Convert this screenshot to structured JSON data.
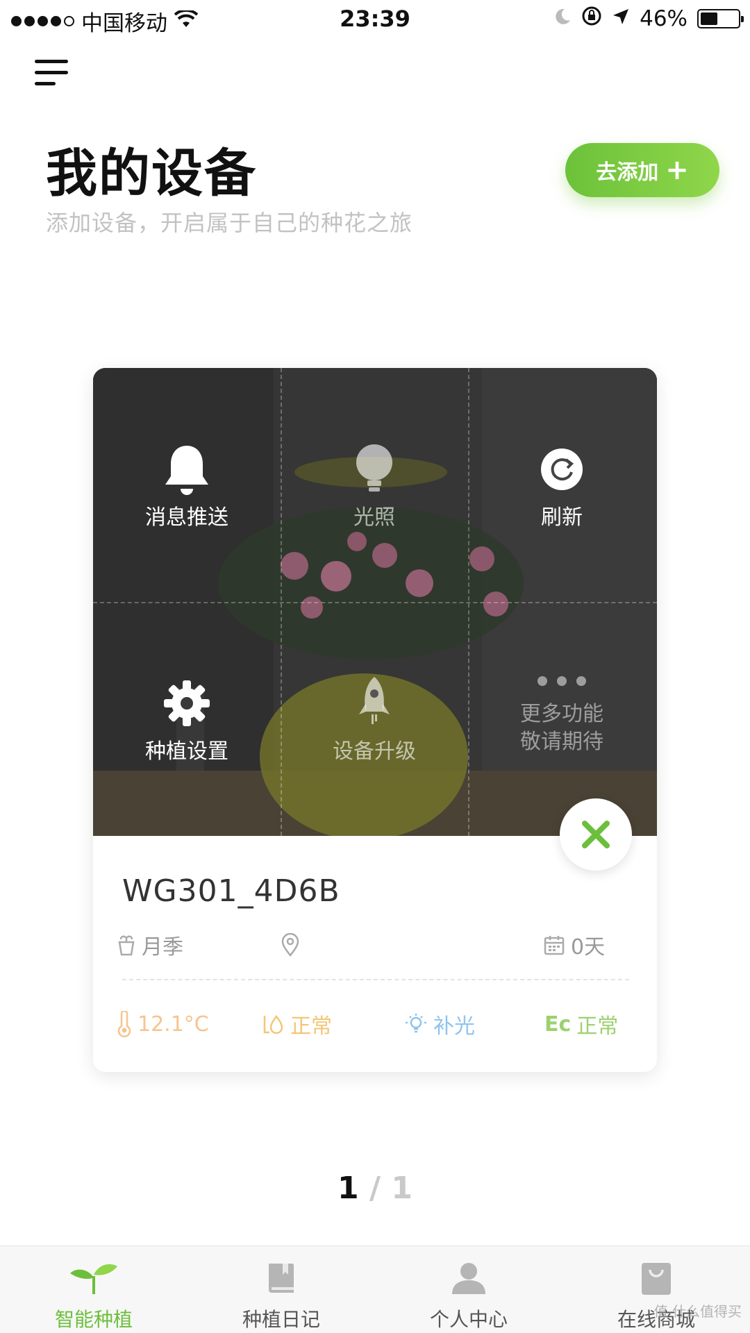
{
  "status_bar": {
    "carrier": "中国移动",
    "time": "23:39",
    "battery_percent": "46%",
    "battery_level": 0.46
  },
  "header": {
    "title": "我的设备",
    "subtitle": "添加设备，开启属于自己的种花之旅",
    "add_button": "去添加"
  },
  "device_card": {
    "actions": [
      {
        "label": "消息推送",
        "icon": "bell-icon"
      },
      {
        "label": "光照",
        "icon": "bulb-icon"
      },
      {
        "label": "刷新",
        "icon": "refresh-icon"
      },
      {
        "label": "种植设置",
        "icon": "gear-icon"
      },
      {
        "label": "设备升级",
        "icon": "rocket-icon"
      },
      {
        "label": "更多功能\n敬请期待",
        "icon": "more-dots-icon"
      }
    ],
    "name": "WG301_4D6B",
    "plant": "月季",
    "location": "",
    "days": "0天",
    "stats": {
      "temperature": "12.1°C",
      "water": "正常",
      "light": "补光",
      "ec_label": "Ec",
      "ec": "正常"
    },
    "colors": {
      "temperature": "#f6c48f",
      "water": "#f3c677",
      "light": "#8ec4ef",
      "ec": "#9dd16f",
      "accent": "#6cbf3c"
    }
  },
  "pager": {
    "current": "1",
    "total": "/ 1"
  },
  "tab_bar": {
    "items": [
      {
        "label": "智能种植",
        "icon": "sprout-icon",
        "active": true
      },
      {
        "label": "种植日记",
        "icon": "book-icon",
        "active": false
      },
      {
        "label": "个人中心",
        "icon": "person-icon",
        "active": false
      },
      {
        "label": "在线商城",
        "icon": "shopping-bag-icon",
        "active": false
      }
    ]
  },
  "watermark": "值 什么值得买"
}
